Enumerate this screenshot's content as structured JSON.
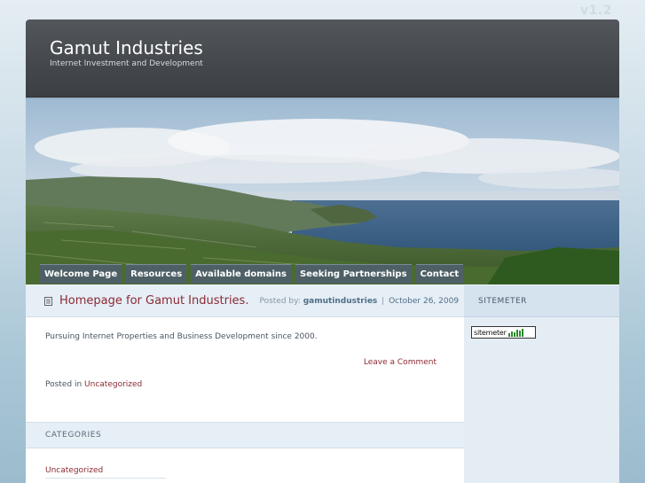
{
  "version": "v1.2",
  "site": {
    "title": "Gamut Industries",
    "description": "Internet Investment and Development"
  },
  "nav": [
    {
      "label": "Welcome Page"
    },
    {
      "label": "Resources"
    },
    {
      "label": "Available domains"
    },
    {
      "label": "Seeking Partnerships"
    },
    {
      "label": "Contact"
    }
  ],
  "post": {
    "title": "Homepage for Gamut Industries.",
    "posted_by_label": "Posted by:",
    "author": "gamutindustries",
    "separator": "|",
    "date": "October 26, 2009",
    "body": "Pursuing Internet Properties and Business Development since 2000.",
    "comment_link": "Leave a Comment",
    "posted_in_label": "Posted in",
    "category": "Uncategorized"
  },
  "categories": {
    "heading": "CATEGORIES",
    "items": [
      "Uncategorized"
    ]
  },
  "sidebar": {
    "heading": "SITEMETER",
    "widget_text": "sitemeter"
  },
  "colors": {
    "accent": "#8b2a32",
    "header_bg": "#4a4e53",
    "nav_bg": "#4e5f6c"
  }
}
